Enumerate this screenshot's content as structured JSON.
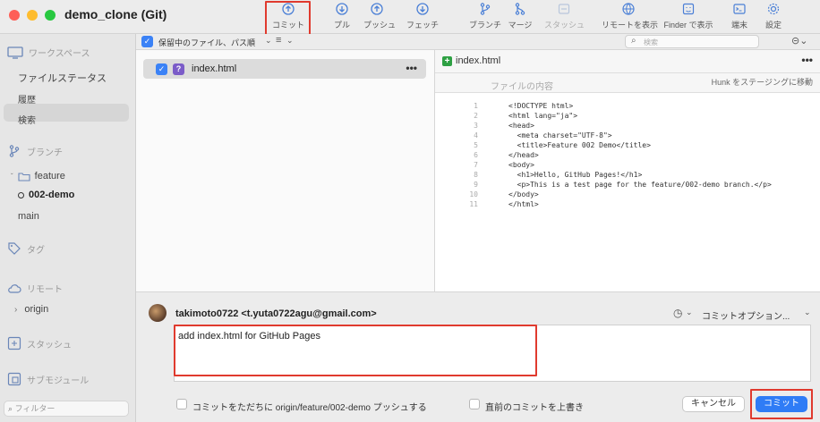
{
  "window": {
    "title": "demo_clone (Git)"
  },
  "toolbar": {
    "commit": "コミット",
    "pull": "プル",
    "push": "プッシュ",
    "fetch": "フェッチ",
    "branch": "ブランチ",
    "merge": "マージ",
    "stash": "スタッシュ",
    "show_remote": "リモートを表示",
    "show_in_finder": "Finder で表示",
    "terminal": "端末",
    "settings": "設定"
  },
  "sidebar": {
    "workspace": "ワークスペース",
    "file_status": "ファイルステータス",
    "history": "履歴",
    "search": "検索",
    "branches": "ブランチ",
    "feature_folder": "feature",
    "current_branch": "002-demo",
    "main_branch": "main",
    "tags": "タグ",
    "remotes": "リモート",
    "origin": "origin",
    "stashes": "スタッシュ",
    "submodules": "サブモジュール",
    "filter_placeholder": "フィルター"
  },
  "filebar": {
    "sort_label": "保留中のファイル、パス順",
    "search_placeholder": "検索"
  },
  "files": [
    {
      "name": "index.html",
      "status": "?"
    }
  ],
  "diff": {
    "file_name": "index.html",
    "contents_label": "ファイルの内容",
    "stage_hunk": "Hunk をステージングに移動",
    "lines": [
      {
        "n": "1",
        "t": "<!DOCTYPE html>"
      },
      {
        "n": "2",
        "t": "<html lang=\"ja\">"
      },
      {
        "n": "3",
        "t": "<head>"
      },
      {
        "n": "4",
        "t": "  <meta charset=\"UTF-8\">"
      },
      {
        "n": "5",
        "t": "  <title>Feature 002 Demo</title>"
      },
      {
        "n": "6",
        "t": "</head>"
      },
      {
        "n": "7",
        "t": "<body>"
      },
      {
        "n": "8",
        "t": "  <h1>Hello, GitHub Pages!</h1>"
      },
      {
        "n": "9",
        "t": "  <p>This is a test page for the feature/002-demo branch.</p>"
      },
      {
        "n": "10",
        "t": "</body>"
      },
      {
        "n": "11",
        "t": "</html>"
      }
    ]
  },
  "commit": {
    "author": "takimoto0722 <t.yuta0722agu@gmail.com>",
    "options": "コミットオプション...",
    "message": "add index.html for GitHub Pages",
    "push_immediately": "コミットをただちに origin/feature/002-demo プッシュする",
    "amend": "直前のコミットを上書き",
    "cancel": "キャンセル",
    "submit": "コミット"
  },
  "colors": {
    "accent": "#2f7cf6",
    "highlight": "#e03a2e",
    "added": "#2ea043"
  }
}
